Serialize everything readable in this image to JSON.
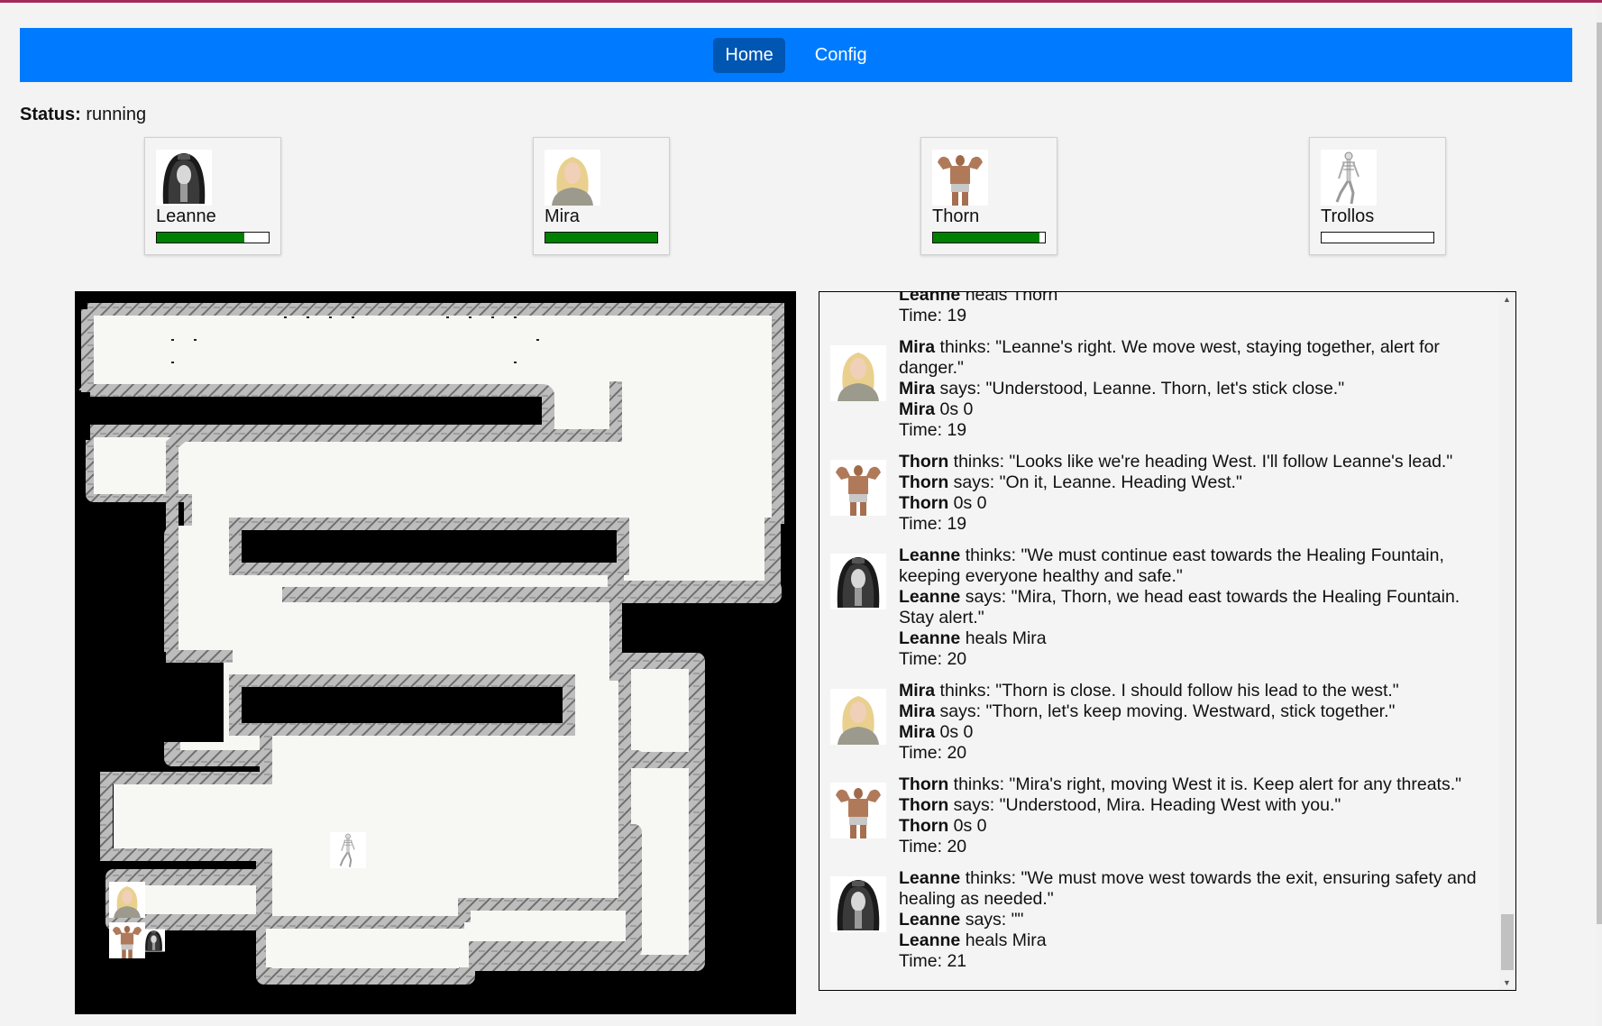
{
  "nav": {
    "items": [
      {
        "label": "Home",
        "active": true
      },
      {
        "label": "Config",
        "active": false
      }
    ]
  },
  "status": {
    "label": "Status:",
    "value": "running"
  },
  "characters": [
    {
      "name": "Leanne",
      "health": 0.78,
      "icon": "dark-sorceress-portrait"
    },
    {
      "name": "Mira",
      "health": 1.0,
      "icon": "blonde-woman-portrait"
    },
    {
      "name": "Thorn",
      "health": 0.95,
      "icon": "muscular-man-portrait"
    },
    {
      "name": "Trollos",
      "health": 0.0,
      "icon": "skeleton-portrait"
    }
  ],
  "colors": {
    "nav_bg": "#007bff",
    "nav_active": "#0056b3",
    "health_fill": "#008000",
    "top_border": "#a3295a"
  },
  "log": {
    "partial_top": {
      "actor": "Leanne",
      "text": " heals Thorn",
      "time": "Time: 19"
    },
    "entries": [
      {
        "actor": "Mira",
        "lines": [
          {
            "actor": "Mira",
            "text": " thinks: \"Leanne's right. We move west, staying together, alert for danger.\""
          },
          {
            "actor": "Mira",
            "text": " says: \"Understood, Leanne. Thorn, let's stick close.\""
          },
          {
            "actor": "Mira",
            "text": " 0s 0"
          }
        ],
        "time": "Time: 19"
      },
      {
        "actor": "Thorn",
        "lines": [
          {
            "actor": "Thorn",
            "text": " thinks: \"Looks like we're heading West. I'll follow Leanne's lead.\""
          },
          {
            "actor": "Thorn",
            "text": " says: \"On it, Leanne. Heading West.\""
          },
          {
            "actor": "Thorn",
            "text": " 0s 0"
          }
        ],
        "time": "Time: 19"
      },
      {
        "actor": "Leanne",
        "lines": [
          {
            "actor": "Leanne",
            "text": " thinks: \"We must continue east towards the Healing Fountain, keeping everyone healthy and safe.\""
          },
          {
            "actor": "Leanne",
            "text": " says: \"Mira, Thorn, we head east towards the Healing Fountain. Stay alert.\""
          },
          {
            "actor": "Leanne",
            "text": " heals Mira"
          }
        ],
        "time": "Time: 20"
      },
      {
        "actor": "Mira",
        "lines": [
          {
            "actor": "Mira",
            "text": " thinks: \"Thorn is close. I should follow his lead to the west.\""
          },
          {
            "actor": "Mira",
            "text": " says: \"Thorn, let's keep moving. Westward, stick together.\""
          },
          {
            "actor": "Mira",
            "text": " 0s 0"
          }
        ],
        "time": "Time: 20"
      },
      {
        "actor": "Thorn",
        "lines": [
          {
            "actor": "Thorn",
            "text": " thinks: \"Mira's right, moving West it is. Keep alert for any threats.\""
          },
          {
            "actor": "Thorn",
            "text": " says: \"Understood, Mira. Heading West with you.\""
          },
          {
            "actor": "Thorn",
            "text": " 0s 0"
          }
        ],
        "time": "Time: 20"
      },
      {
        "actor": "Leanne",
        "lines": [
          {
            "actor": "Leanne",
            "text": " thinks: \"We must move west towards the exit, ensuring safety and healing as needed.\""
          },
          {
            "actor": "Leanne",
            "text": " says: \"\""
          },
          {
            "actor": "Leanne",
            "text": " heals Mira"
          }
        ],
        "time": "Time: 21"
      }
    ]
  },
  "map": {
    "tokens": [
      {
        "name": "Mira",
        "icon": "blonde-woman-portrait"
      },
      {
        "name": "Thorn",
        "icon": "muscular-man-portrait"
      },
      {
        "name": "Leanne",
        "icon": "dark-sorceress-portrait"
      },
      {
        "name": "Trollos",
        "icon": "skeleton-portrait"
      }
    ]
  }
}
